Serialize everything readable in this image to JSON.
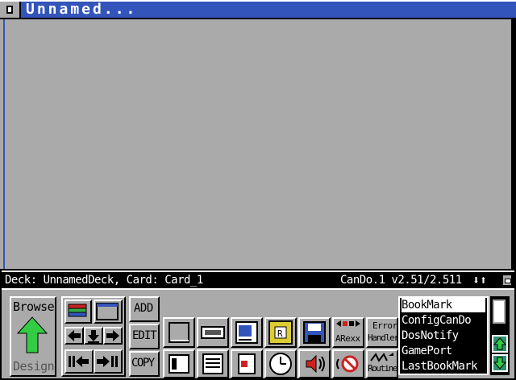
{
  "window": {
    "title": "Unnamed..."
  },
  "status": {
    "deck_card": "Deck: UnnamedDeck,  Card: Card_1",
    "version": "CanDo.1 v2.51/2.511",
    "arrows": "⬇⬆"
  },
  "mode": {
    "browse": "Browse",
    "design": "Design"
  },
  "buttons": {
    "add": "ADD",
    "edit": "EDIT",
    "copy": "COPY"
  },
  "tools": {
    "arexx": "ARexx",
    "error_line1": "Error",
    "error_line2": "Handler",
    "routines": "Routines"
  },
  "object_list": {
    "items": [
      "BookMark",
      "ConfigCanDo",
      "DosNotify",
      "GamePort",
      "LastBookMark"
    ],
    "selected": 0
  },
  "colors": {
    "title_bar": "#3355bb",
    "panel": "#aaaaaa",
    "arrow_green": "#33cc44",
    "scroll_teal": "#2f8f6f"
  }
}
